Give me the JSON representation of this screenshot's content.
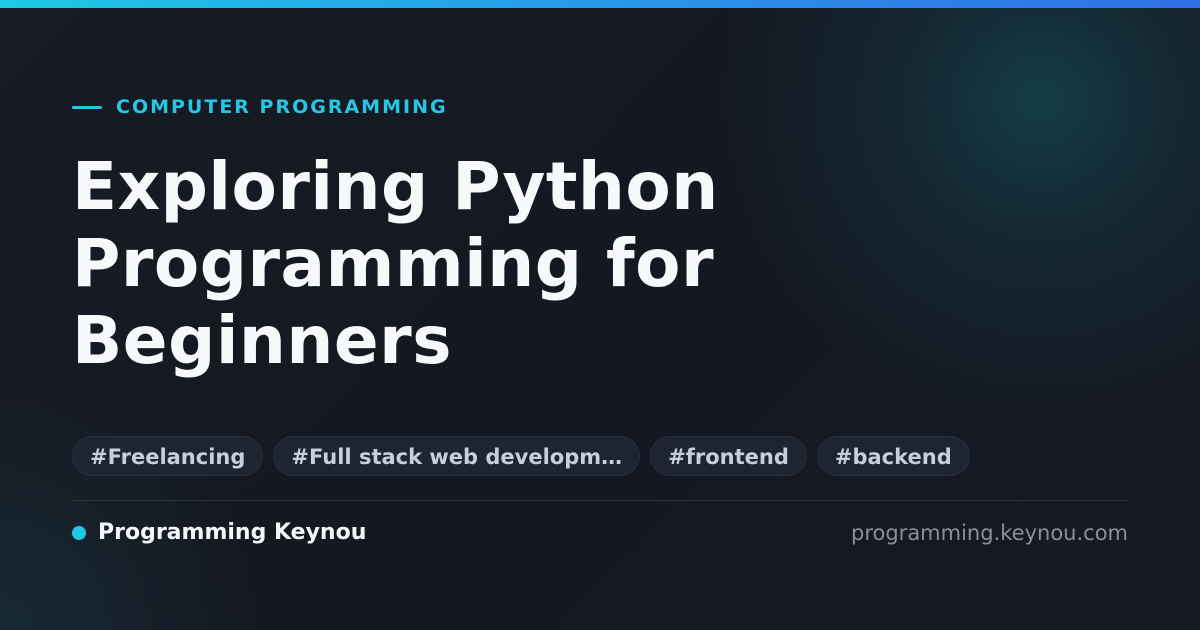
{
  "card": {
    "category": "COMPUTER PROGRAMMING",
    "title": "Exploring Python Programming for Beginners",
    "tags": [
      "#Freelancing",
      "#Full stack web developm…",
      "#frontend",
      "#backend"
    ],
    "author": "Programming Keynou",
    "domain": "programming.keynou.com"
  },
  "colors": {
    "accent": "#22c7e8",
    "background": "#141820",
    "top_bar_start": "#1ec8e6",
    "top_bar_end": "#2f6fe6",
    "title_text": "#f7f8fa",
    "tag_text": "#c9cfd9",
    "tag_background": "#1e2634",
    "domain_text": "#8a919c"
  }
}
